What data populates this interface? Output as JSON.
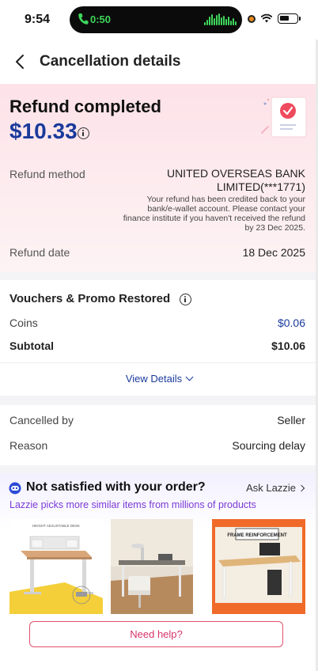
{
  "status_bar": {
    "time": "9:54",
    "call_time": "0:50"
  },
  "header": {
    "title": "Cancellation details"
  },
  "refund": {
    "title": "Refund completed",
    "amount": "$10.33",
    "method_label": "Refund method",
    "method_value": "UNITED OVERSEAS BANK LIMITED(***1771)",
    "note": "Your refund has been credited back to your bank/e-wallet account. Please contact your finance institute if you haven't received the refund by 23 Dec 2025.",
    "date_label": "Refund date",
    "date_value": "18 Dec 2025"
  },
  "vouchers": {
    "title": "Vouchers & Promo Restored",
    "coins_label": "Coins",
    "coins_value": "$0.06",
    "subtotal_label": "Subtotal",
    "subtotal_value": "$10.06",
    "view_details": "View Details"
  },
  "cancellation": {
    "by_label": "Cancelled by",
    "by_value": "Seller",
    "reason_label": "Reason",
    "reason_value": "Sourcing delay"
  },
  "recommendations": {
    "title": "Not satisfied with your order?",
    "ask": "Ask Lazzie",
    "subtitle": "Lazzie picks more similar items from millions of products",
    "products": [
      {
        "icon": "standing-desk-image",
        "caption": "HEIGHT ADJUSTABLE DESK"
      },
      {
        "icon": "office-desk-image"
      },
      {
        "icon": "frame-desk-image",
        "banner": "FRAME REINFORCEMENT"
      }
    ]
  },
  "footer": {
    "help_label": "Need help?"
  },
  "colors": {
    "accent_blue": "#1a3a9c",
    "brand_pink": "#d6336c",
    "lazzie_purple": "#7a3ad6"
  }
}
